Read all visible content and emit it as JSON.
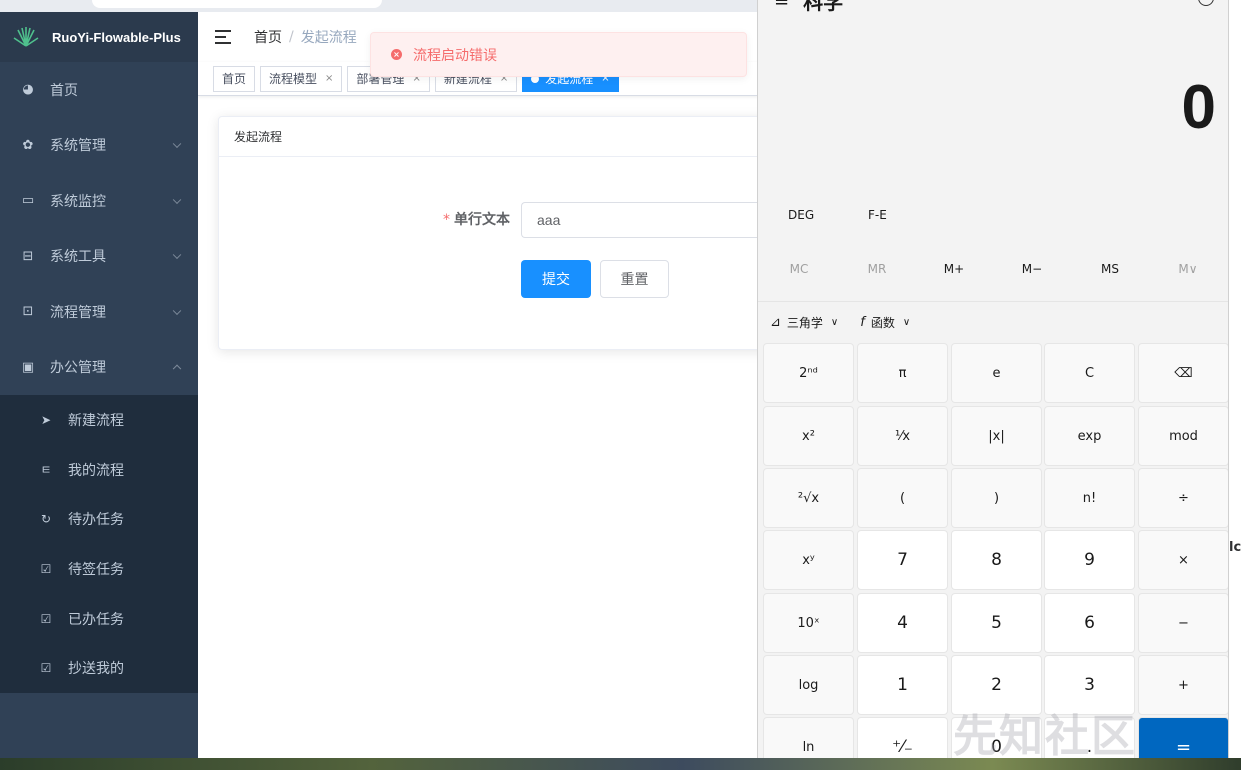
{
  "app": {
    "logo_text": "RuoYi-Flowable-Plus"
  },
  "sidebar": {
    "items": [
      {
        "label": "首页",
        "icon": "dashboard-icon"
      },
      {
        "label": "系统管理",
        "icon": "gear-icon"
      },
      {
        "label": "系统监控",
        "icon": "monitor-icon"
      },
      {
        "label": "系统工具",
        "icon": "toolbox-icon"
      },
      {
        "label": "流程管理",
        "icon": "flow-icon"
      },
      {
        "label": "办公管理",
        "icon": "office-icon"
      }
    ],
    "submenu": [
      {
        "label": "新建流程",
        "icon": "send-icon"
      },
      {
        "label": "我的流程",
        "icon": "tree-icon"
      },
      {
        "label": "待办任务",
        "icon": "clock-icon"
      },
      {
        "label": "待签任务",
        "icon": "checkbox-icon"
      },
      {
        "label": "已办任务",
        "icon": "checkbox-icon"
      },
      {
        "label": "抄送我的",
        "icon": "checkbox-icon"
      }
    ]
  },
  "header": {
    "breadcrumb": [
      "首页",
      "/",
      "发起流程"
    ]
  },
  "tags": [
    {
      "label": "首页"
    },
    {
      "label": "流程模型",
      "close": "×"
    },
    {
      "label": "部署管理",
      "close": "×"
    },
    {
      "label": "新建流程",
      "close": "×"
    },
    {
      "label": "发起流程",
      "close": "×"
    }
  ],
  "toast": {
    "message": "流程启动错误",
    "type": "error",
    "icon": "×"
  },
  "card": {
    "title": "发起流程",
    "field_label": "单行文本",
    "required_mark": "*",
    "field_value": "aaa",
    "submit_label": "提交",
    "reset_label": "重置"
  },
  "calculator": {
    "title": "科学",
    "menu_icon": "≡",
    "display": "0",
    "angle_mode": "DEG",
    "fe_mode": "F-E",
    "memory": [
      "MC",
      "MR",
      "M+",
      "M−",
      "MS",
      "M∨"
    ],
    "trig_label": "三角学",
    "trig_icon": "⊿",
    "func_label": "函数",
    "func_icon": "f",
    "dropdown": "∨",
    "keys": [
      [
        "2ⁿᵈ",
        "π",
        "e",
        "C",
        "⌫"
      ],
      [
        "x²",
        "¹⁄x",
        "|x|",
        "exp",
        "mod"
      ],
      [
        "²√x",
        "(",
        ")",
        "n!",
        "÷"
      ],
      [
        "xʸ",
        "7",
        "8",
        "9",
        "×"
      ],
      [
        "10ˣ",
        "4",
        "5",
        "6",
        "−"
      ],
      [
        "log",
        "1",
        "2",
        "3",
        "+"
      ],
      [
        "ln",
        "⁺⁄₋",
        "0",
        ".",
        "="
      ]
    ]
  },
  "edge": {
    "partial_text": "lc"
  },
  "watermark": "先知社区",
  "colors": {
    "sidebar_bg": "#304156",
    "submenu_bg": "#1f2d3d",
    "primary": "#1890ff",
    "error": "#f56c6c",
    "calc_equals": "#0067c0"
  }
}
